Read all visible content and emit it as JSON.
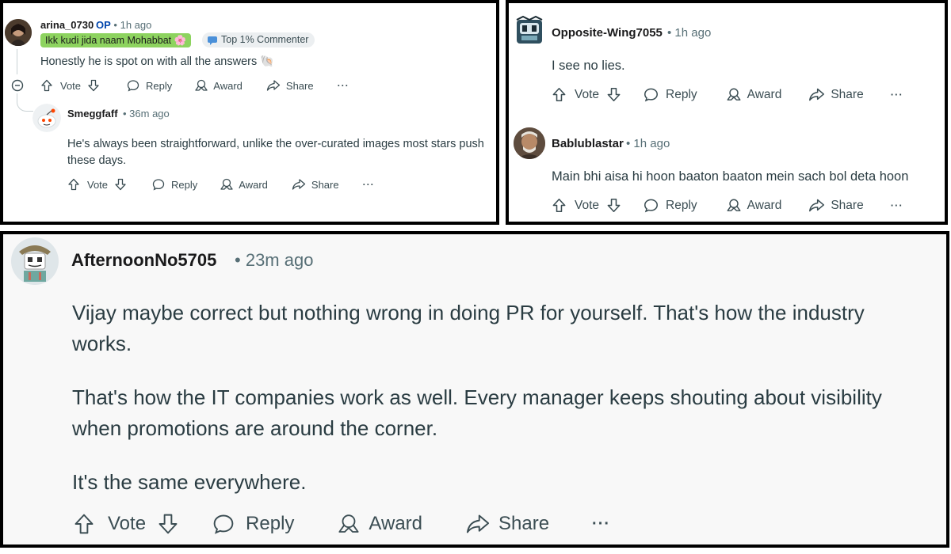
{
  "panel_top_left": {
    "comment_1": {
      "username": "arina_0730",
      "op_tag": "OP",
      "time": "1h ago",
      "flair": "Ikk kudi jida naam Mohabbat 🌸",
      "badge": "Top 1% Commenter",
      "body": "Honestly he is spot on with all the answers 🐚",
      "actions": {
        "vote": "Vote",
        "reply": "Reply",
        "award": "Award",
        "share": "Share",
        "more": "···"
      }
    },
    "comment_2": {
      "username": "Smeggfaff",
      "time": "36m ago",
      "body": "He's always been straightforward, unlike the over-curated images most stars push these days.",
      "actions": {
        "vote": "Vote",
        "reply": "Reply",
        "award": "Award",
        "share": "Share",
        "more": "···"
      }
    }
  },
  "panel_top_right": {
    "comment_1": {
      "username": "Opposite-Wing7055",
      "time": "1h ago",
      "body": "I see no lies.",
      "actions": {
        "vote": "Vote",
        "reply": "Reply",
        "award": "Award",
        "share": "Share",
        "more": "···"
      }
    },
    "comment_2": {
      "username": "Bablublastar",
      "time": "1h ago",
      "body": "Main bhi aisa hi hoon baaton baaton mein sach bol deta hoon",
      "actions": {
        "vote": "Vote",
        "reply": "Reply",
        "award": "Award",
        "share": "Share",
        "more": "···"
      }
    }
  },
  "panel_bottom": {
    "comment_1": {
      "username": "AfternoonNo5705",
      "time": "23m ago",
      "paragraph_1": "Vijay maybe correct but nothing wrong in doing PR for yourself. That's how the industry works.",
      "paragraph_2": "That's how the IT companies work as well. Every manager keeps shouting about visibility when promotions are around the corner.",
      "paragraph_3": "It's the same everywhere.",
      "actions": {
        "vote": "Vote",
        "reply": "Reply",
        "award": "Award",
        "share": "Share",
        "more": "···"
      }
    }
  },
  "icons": [
    "upvote-icon",
    "downvote-icon",
    "reply-icon",
    "award-icon",
    "share-icon",
    "more-icon",
    "collapse-icon",
    "avatar-image"
  ]
}
